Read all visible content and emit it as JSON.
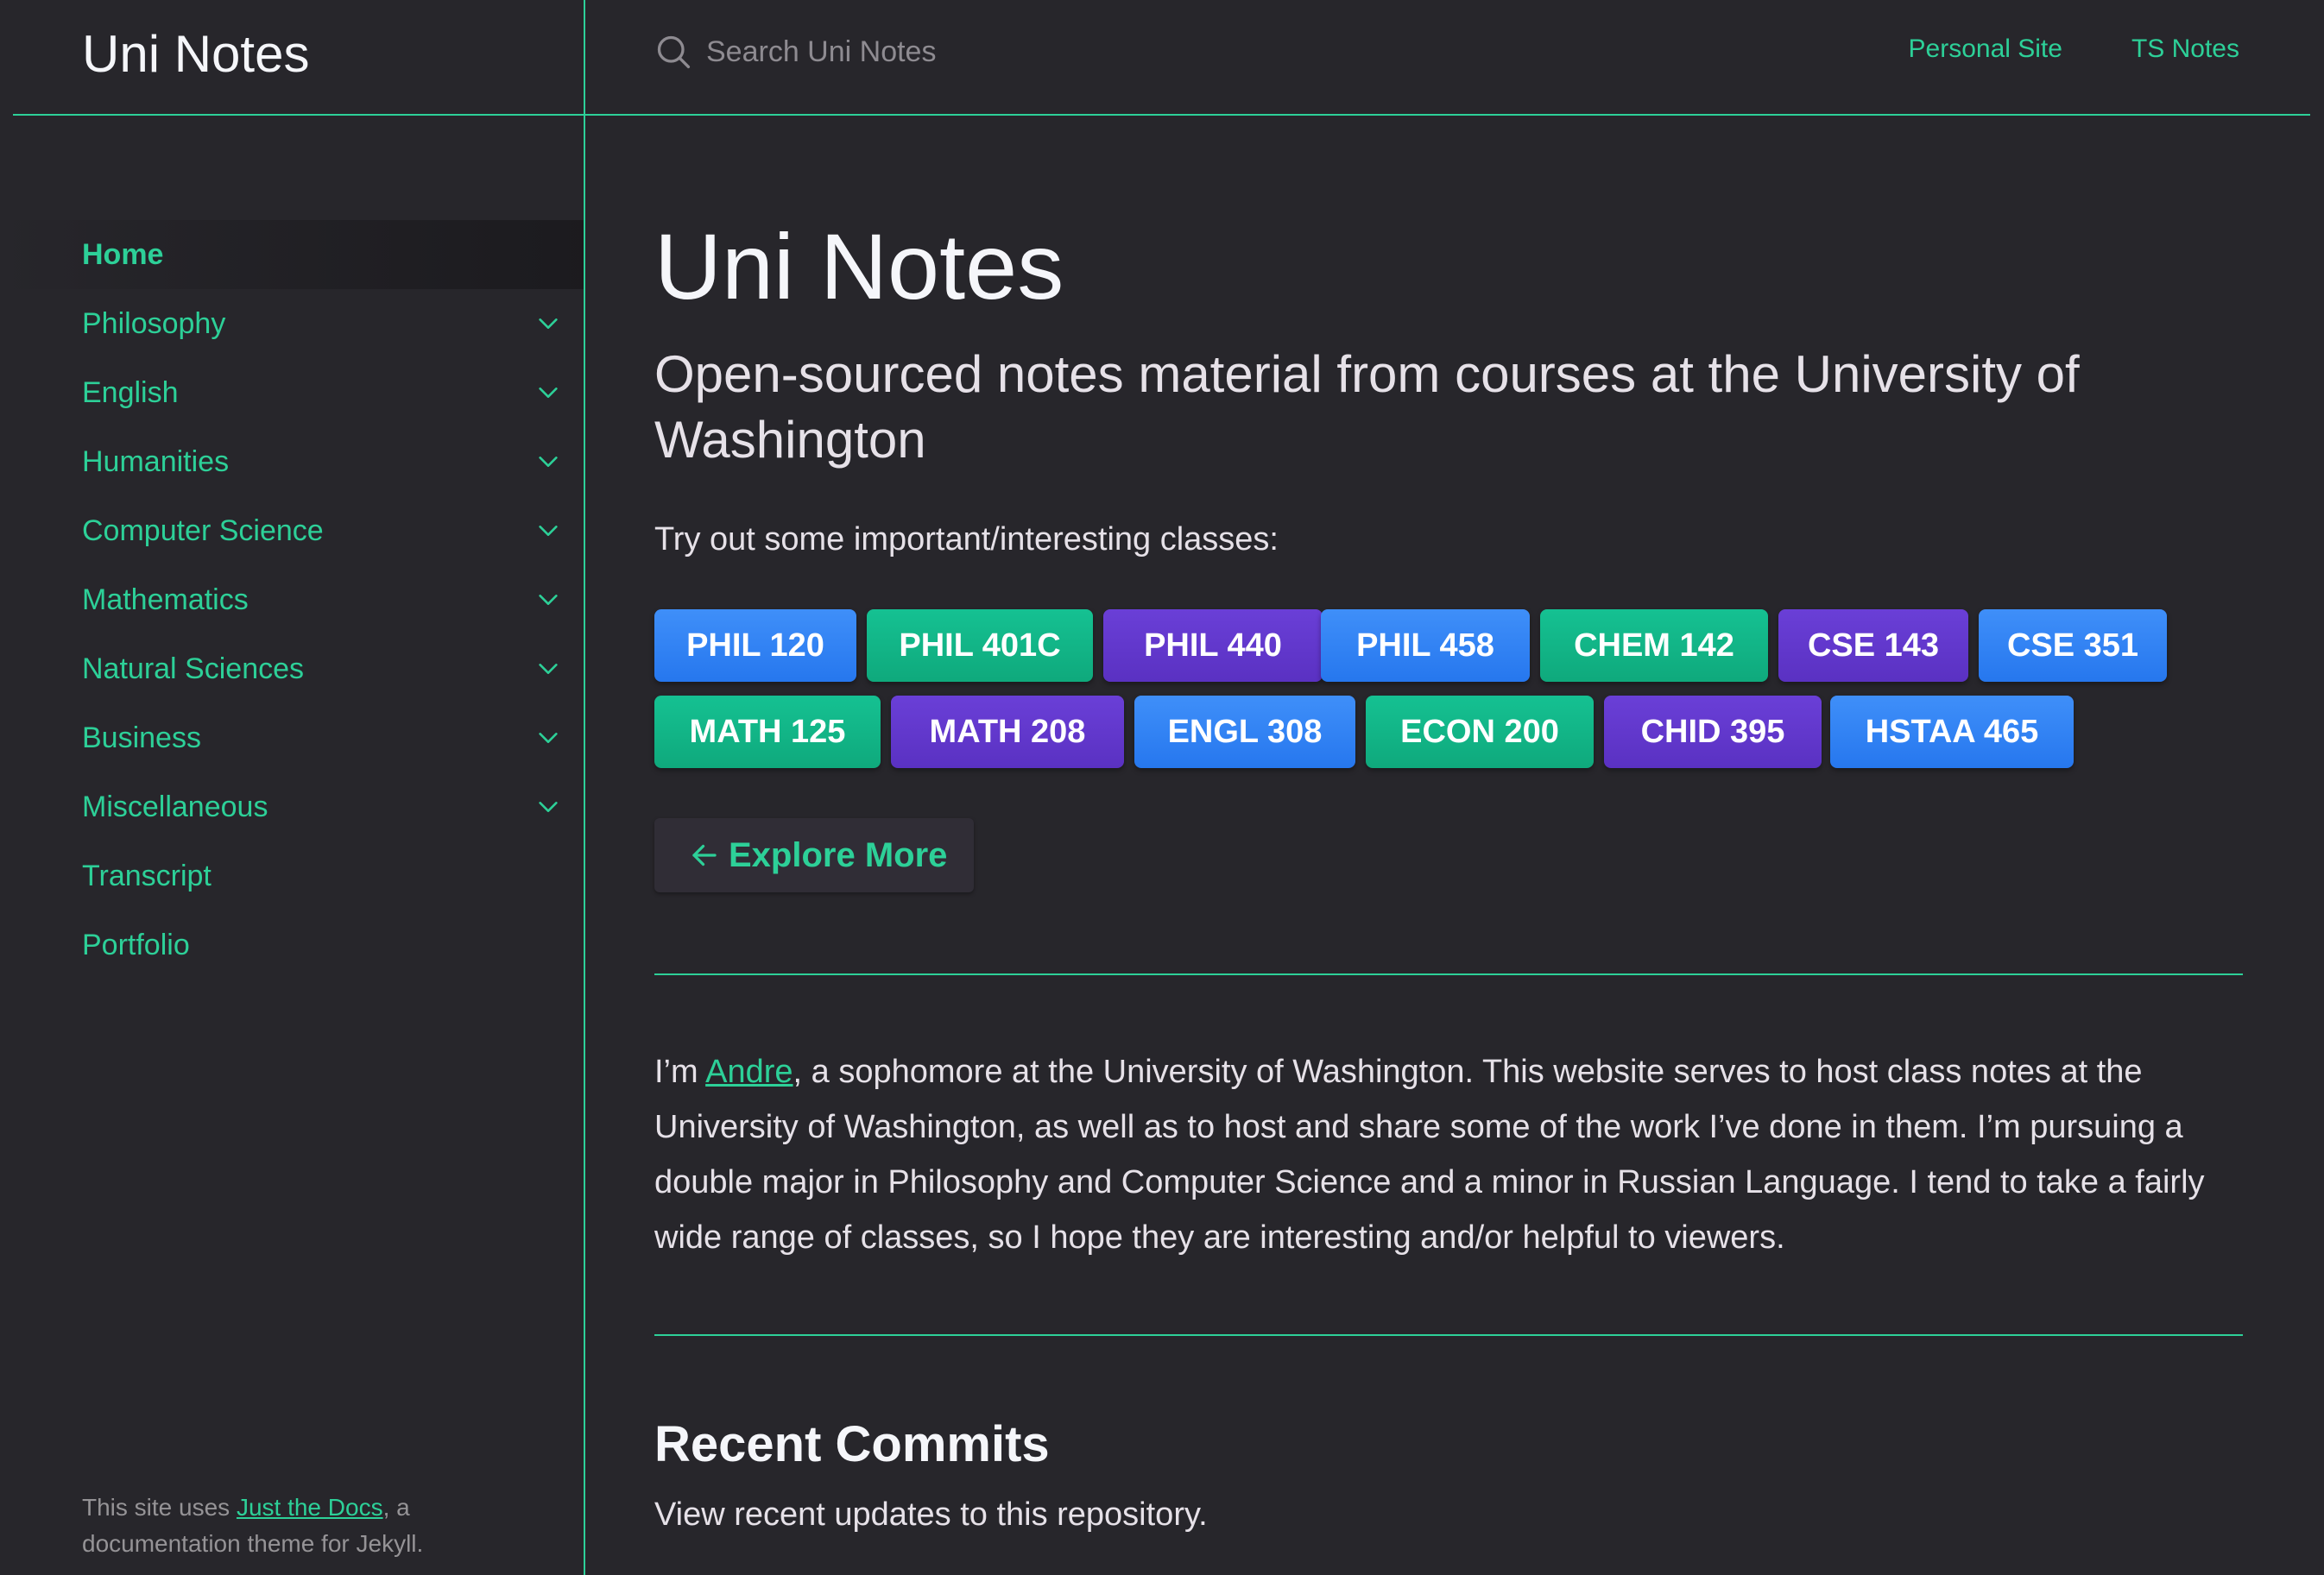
{
  "site": {
    "title": "Uni Notes"
  },
  "search": {
    "placeholder": "Search Uni Notes"
  },
  "aux_links": [
    "Personal Site",
    "TS Notes"
  ],
  "nav": {
    "items": [
      {
        "label": "Home",
        "active": true,
        "expandable": false
      },
      {
        "label": "Philosophy",
        "active": false,
        "expandable": true
      },
      {
        "label": "English",
        "active": false,
        "expandable": true
      },
      {
        "label": "Humanities",
        "active": false,
        "expandable": true
      },
      {
        "label": "Computer Science",
        "active": false,
        "expandable": true
      },
      {
        "label": "Mathematics",
        "active": false,
        "expandable": true
      },
      {
        "label": "Natural Sciences",
        "active": false,
        "expandable": true
      },
      {
        "label": "Business",
        "active": false,
        "expandable": true
      },
      {
        "label": "Miscellaneous",
        "active": false,
        "expandable": true
      },
      {
        "label": "Transcript",
        "active": false,
        "expandable": false
      },
      {
        "label": "Portfolio",
        "active": false,
        "expandable": false
      }
    ],
    "chevron_icon": "chevron-down-icon"
  },
  "footer": {
    "prefix": "This site uses ",
    "link": "Just the Docs",
    "suffix": ", a documentation theme for Jekyll."
  },
  "main": {
    "title": "Uni Notes",
    "lead": "Open-sourced notes material from courses at the University of Washington",
    "try_text": "Try out some important/interesting classes:",
    "class_rows": [
      [
        {
          "label": "PHIL 120",
          "color": "blue"
        },
        {
          "label": "PHIL 401C",
          "color": "green"
        },
        {
          "label": "PHIL 440",
          "color": "purple"
        },
        {
          "label": "PHIL 458",
          "color": "blue"
        },
        {
          "label": "CHEM 142",
          "color": "green"
        },
        {
          "label": "CSE 143",
          "color": "purple"
        },
        {
          "label": "CSE 351",
          "color": "blue"
        }
      ],
      [
        {
          "label": "MATH 125",
          "color": "green"
        },
        {
          "label": "MATH 208",
          "color": "purple"
        },
        {
          "label": "ENGL 308",
          "color": "blue"
        },
        {
          "label": "ECON 200",
          "color": "green"
        },
        {
          "label": "CHID 395",
          "color": "purple"
        },
        {
          "label": "HSTAA 465",
          "color": "blue"
        }
      ]
    ],
    "explore_label": "Explore More",
    "intro": {
      "before": "I’m ",
      "link": "Andre",
      "after": ", a sophomore at the University of Washington. This website serves to host class notes at the University of Washington, as well as to host and share some of the work I’ve done in them. I’m pursuing a double major in Philosophy and Computer Science and a minor in Russian Language. I tend to take a fairly wide range of classes, so I hope they are interesting and/or helpful to viewers."
    },
    "recent_title": "Recent Commits",
    "recent_sub": "View recent updates to this repository."
  },
  "colors": {
    "background": "#27262b",
    "accent": "#2dd098",
    "chip_blue": "#2e80f2",
    "chip_green": "#12b586",
    "chip_purple": "#6138cc"
  }
}
